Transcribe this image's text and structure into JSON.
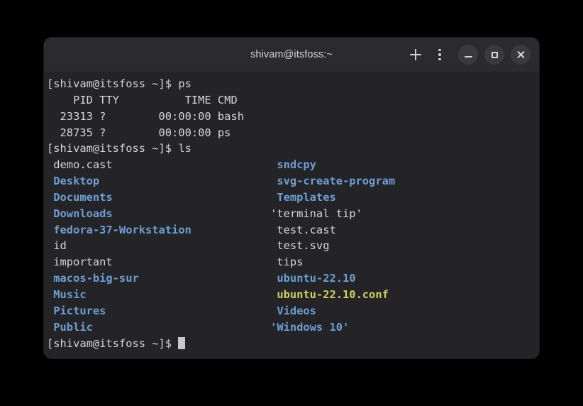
{
  "window": {
    "title": "shivam@itsfoss:~",
    "controls": {
      "new_tab_label": "+",
      "menu_label": "⋮",
      "minimize_label": "–",
      "maximize_label": "□",
      "close_label": "×"
    }
  },
  "colors": {
    "page_background": "#000000",
    "titlebar_background": "#2b2b2e",
    "terminal_background": "#242427",
    "default_text": "#d6d6d6",
    "directory_blue": "#6a9fd4",
    "config_yellow": "#cfcf5d",
    "cursor": "#c8c8c8"
  },
  "terminal": {
    "prompt": "[shivam@itsfoss ~]$ ",
    "lines": [
      {
        "type": "command",
        "prompt": "[shivam@itsfoss ~]$ ",
        "command": "ps"
      },
      {
        "type": "output",
        "text": "    PID TTY          TIME CMD"
      },
      {
        "type": "output",
        "text": "  23313 ?        00:00:00 bash"
      },
      {
        "type": "output",
        "text": "  28735 ?        00:00:00 ps"
      },
      {
        "type": "command",
        "prompt": "[shivam@itsfoss ~]$ ",
        "command": "ls"
      }
    ],
    "ls_columns": {
      "left_width_chars": 34,
      "left_indent": " ",
      "rows": [
        {
          "left": {
            "name": "demo.cast",
            "color": "default",
            "quoted": false
          },
          "right": {
            "name": "sndcpy",
            "color": "dir",
            "quoted": false
          }
        },
        {
          "left": {
            "name": "Desktop",
            "color": "dir",
            "quoted": false
          },
          "right": {
            "name": "svg-create-program",
            "color": "dir",
            "quoted": false
          }
        },
        {
          "left": {
            "name": "Documents",
            "color": "dir",
            "quoted": false
          },
          "right": {
            "name": "Templates",
            "color": "dir",
            "quoted": false
          }
        },
        {
          "left": {
            "name": "Downloads",
            "color": "dir",
            "quoted": false
          },
          "right": {
            "name": "terminal tip",
            "color": "default",
            "quoted": true
          }
        },
        {
          "left": {
            "name": "fedora-37-Workstation",
            "color": "dir",
            "quoted": false
          },
          "right": {
            "name": "test.cast",
            "color": "default",
            "quoted": false
          }
        },
        {
          "left": {
            "name": "id",
            "color": "default",
            "quoted": false
          },
          "right": {
            "name": "test.svg",
            "color": "default",
            "quoted": false
          }
        },
        {
          "left": {
            "name": "important",
            "color": "default",
            "quoted": false
          },
          "right": {
            "name": "tips",
            "color": "default",
            "quoted": false
          }
        },
        {
          "left": {
            "name": "macos-big-sur",
            "color": "dir",
            "quoted": false
          },
          "right": {
            "name": "ubuntu-22.10",
            "color": "dir",
            "quoted": false
          }
        },
        {
          "left": {
            "name": "Music",
            "color": "dir",
            "quoted": false
          },
          "right": {
            "name": "ubuntu-22.10.conf",
            "color": "conf",
            "quoted": false
          }
        },
        {
          "left": {
            "name": "Pictures",
            "color": "dir",
            "quoted": false
          },
          "right": {
            "name": "Videos",
            "color": "dir",
            "quoted": false
          }
        },
        {
          "left": {
            "name": "Public",
            "color": "dir",
            "quoted": false
          },
          "right": {
            "name": "Windows 10",
            "color": "dir",
            "quoted": true
          }
        }
      ]
    },
    "final_prompt": "[shivam@itsfoss ~]$ ",
    "cursor_visible": true
  }
}
